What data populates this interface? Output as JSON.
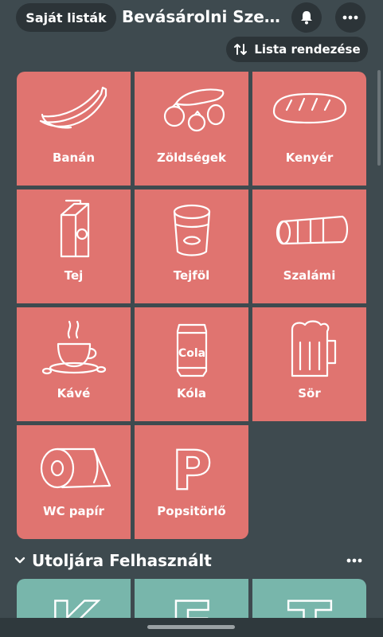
{
  "header": {
    "back_label": "Saját listák",
    "title": "Bevásárolni Szere...",
    "bell_icon": "bell-icon",
    "more_icon": "more-dots-icon"
  },
  "sort": {
    "label": "Lista rendezése",
    "icon": "sort-arrows-icon"
  },
  "items": [
    {
      "label": "Banán",
      "icon": "banana-icon"
    },
    {
      "label": "Zöldségek",
      "icon": "vegetables-icon"
    },
    {
      "label": "Kenyér",
      "icon": "bread-icon"
    },
    {
      "label": "Tej",
      "icon": "milk-carton-icon"
    },
    {
      "label": "Tejföl",
      "icon": "sour-cream-icon"
    },
    {
      "label": "Szalámi",
      "icon": "salami-icon"
    },
    {
      "label": "Kávé",
      "icon": "coffee-cup-icon"
    },
    {
      "label": "Kóla",
      "icon": "cola-can-icon"
    },
    {
      "label": "Sör",
      "icon": "beer-mug-icon"
    },
    {
      "label": "WC papír",
      "icon": "toilet-paper-icon"
    },
    {
      "label": "Popsitörlő",
      "icon": "letter-p-icon"
    }
  ],
  "cola_can_text": "Cola",
  "popsi_letter": "P",
  "recent": {
    "title": "Utoljára Felhasznált",
    "letters": [
      "K",
      "E",
      "T"
    ]
  },
  "colors": {
    "background": "#3e4a4f",
    "tile": "#e07470",
    "recent_tile": "#78b6ab",
    "pill": "#2c3438"
  }
}
